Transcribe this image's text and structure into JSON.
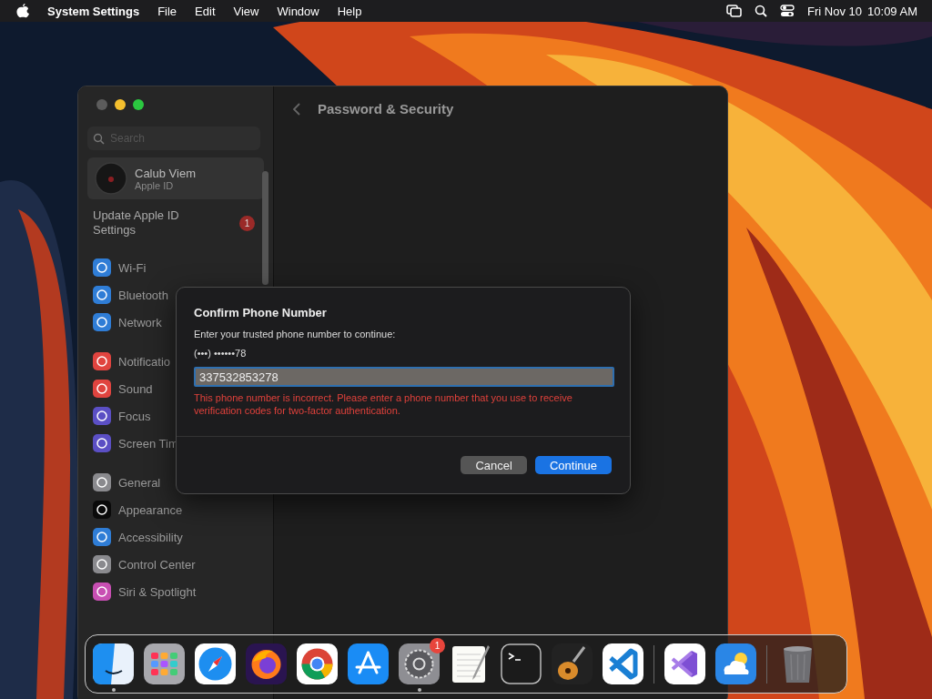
{
  "menu_bar": {
    "app_name": "System Settings",
    "menus": [
      "File",
      "Edit",
      "View",
      "Window",
      "Help"
    ],
    "date": "Fri Nov 10",
    "time": "10:09 AM"
  },
  "window": {
    "title": "Password & Security"
  },
  "sidebar": {
    "search": {
      "placeholder": "Search"
    },
    "account": {
      "name": "Calub Viem",
      "subtitle": "Apple ID"
    },
    "notice": {
      "label": "Update Apple ID Settings",
      "badge": "1"
    },
    "groups": [
      [
        {
          "label": "Wi-Fi",
          "color": "#2f7dd6"
        },
        {
          "label": "Bluetooth",
          "color": "#2f7dd6"
        },
        {
          "label": "Network",
          "color": "#2f7dd6"
        }
      ],
      [
        {
          "label": "Notificatio",
          "color": "#e0443f"
        },
        {
          "label": "Sound",
          "color": "#e0443f"
        },
        {
          "label": "Focus",
          "color": "#5b4fc4"
        },
        {
          "label": "Screen Tim",
          "color": "#5b4fc4"
        }
      ],
      [
        {
          "label": "General",
          "color": "#8a8a8e"
        },
        {
          "label": "Appearance",
          "color": "#0a0a0a"
        },
        {
          "label": "Accessibility",
          "color": "#2f7dd6"
        },
        {
          "label": "Control Center",
          "color": "#8a8a8e"
        },
        {
          "label": "Siri & Spotlight",
          "color": "#c84fb3"
        }
      ]
    ]
  },
  "dialog": {
    "title": "Confirm Phone Number",
    "prompt": "Enter your trusted phone number to continue:",
    "masked_number": "(•••) ••••••78",
    "field": {
      "value": "337532853278",
      "error": true
    },
    "error_message": "This phone number is incorrect. Please enter a phone number that you use to receive verification codes for two-factor authentication.",
    "buttons": [
      {
        "label": "Cancel",
        "default": false
      },
      {
        "label": "Continue",
        "default": true
      }
    ]
  },
  "dock": {
    "items": [
      {
        "kind": "finder",
        "running": true
      },
      {
        "kind": "launchpad",
        "running": false
      },
      {
        "kind": "safari",
        "running": false
      },
      {
        "kind": "firefox",
        "running": false
      },
      {
        "kind": "chrome",
        "running": false
      },
      {
        "kind": "appstore",
        "running": false
      },
      {
        "kind": "settings",
        "running": true,
        "badge": "1"
      },
      {
        "kind": "textedit",
        "running": false
      },
      {
        "kind": "terminal",
        "running": false
      },
      {
        "kind": "garageband",
        "running": false
      },
      {
        "kind": "vscode",
        "running": false
      },
      {
        "kind": "separator"
      },
      {
        "kind": "visualstudio",
        "running": false
      },
      {
        "kind": "weather",
        "running": false
      },
      {
        "kind": "separator"
      },
      {
        "kind": "trash",
        "running": false
      }
    ]
  }
}
